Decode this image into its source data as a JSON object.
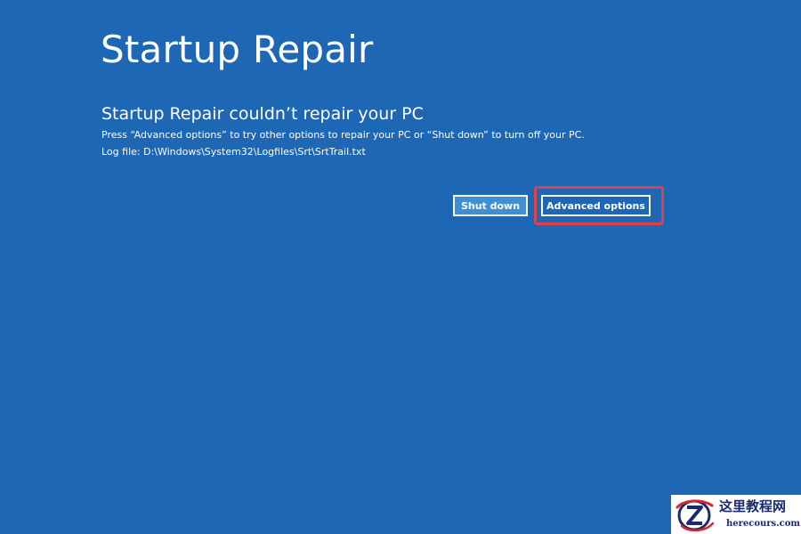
{
  "page": {
    "title": "Startup Repair",
    "heading": "Startup Repair couldn’t repair your PC",
    "description": "Press “Advanced options” to try other options to repair your PC or “Shut down” to turn off your PC.",
    "log_file": "Log file: D:\\Windows\\System32\\Logfiles\\Srt\\SrtTrail.txt"
  },
  "buttons": {
    "shut_down": "Shut down",
    "advanced_options": "Advanced options"
  },
  "highlight": {
    "target": "advanced-options-button",
    "color": "#e0404a"
  },
  "watermark": {
    "name": "这里教程网",
    "url": "herecours.com",
    "logo_icon": "z-logo-icon"
  },
  "colors": {
    "background": "#1e67b4",
    "text": "#ffffff",
    "shutdown_button_fill": "#3f8fd2"
  }
}
